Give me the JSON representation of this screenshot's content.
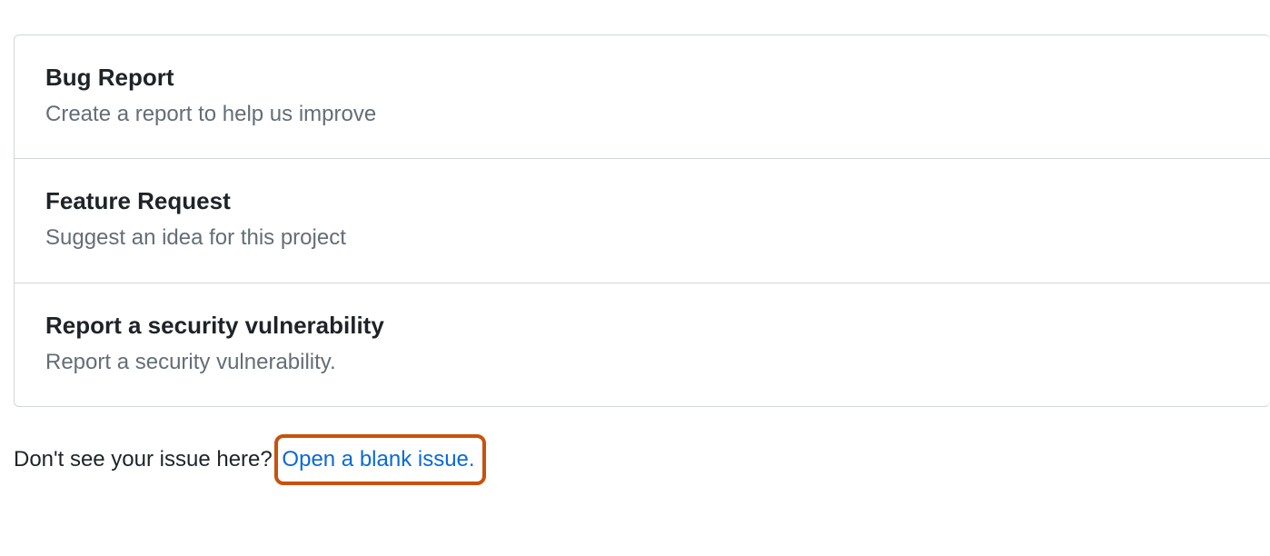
{
  "templates": [
    {
      "title": "Bug Report",
      "description": "Create a report to help us improve"
    },
    {
      "title": "Feature Request",
      "description": "Suggest an idea for this project"
    },
    {
      "title": "Report a security vulnerability",
      "description": "Report a security vulnerability."
    }
  ],
  "footer": {
    "prompt": "Don't see your issue here? ",
    "link_text": "Open a blank issue."
  }
}
